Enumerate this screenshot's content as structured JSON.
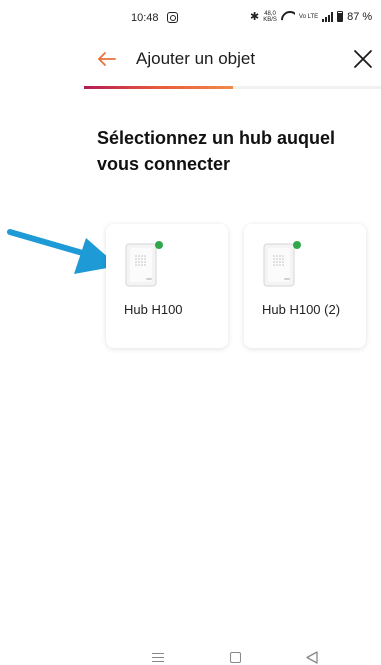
{
  "status_bar": {
    "time": "10:48",
    "network_speed_value": "48,0",
    "network_speed_unit": "KB/S",
    "volte": "Vo LTE",
    "battery": "87 %",
    "icons": [
      "instagram-icon",
      "bluetooth-icon",
      "wifi-icon",
      "signal-icon",
      "battery-icon"
    ]
  },
  "header": {
    "title": "Ajouter un objet",
    "back_icon": "back-arrow-icon",
    "close_icon": "close-icon",
    "progress": 0.5
  },
  "page": {
    "title": "Sélectionnez un hub auquel vous connecter"
  },
  "hubs": [
    {
      "name": "Hub H100",
      "status_color": "#2ea84a"
    },
    {
      "name": "Hub H100 (2)",
      "status_color": "#2ea84a"
    }
  ],
  "colors": {
    "accent": "#e8713c",
    "progress_start": "#b21c55",
    "pointer_arrow": "#1e9bd7"
  },
  "nav_bar": {
    "icons": [
      "menu-icon",
      "home-icon",
      "back-icon"
    ]
  }
}
